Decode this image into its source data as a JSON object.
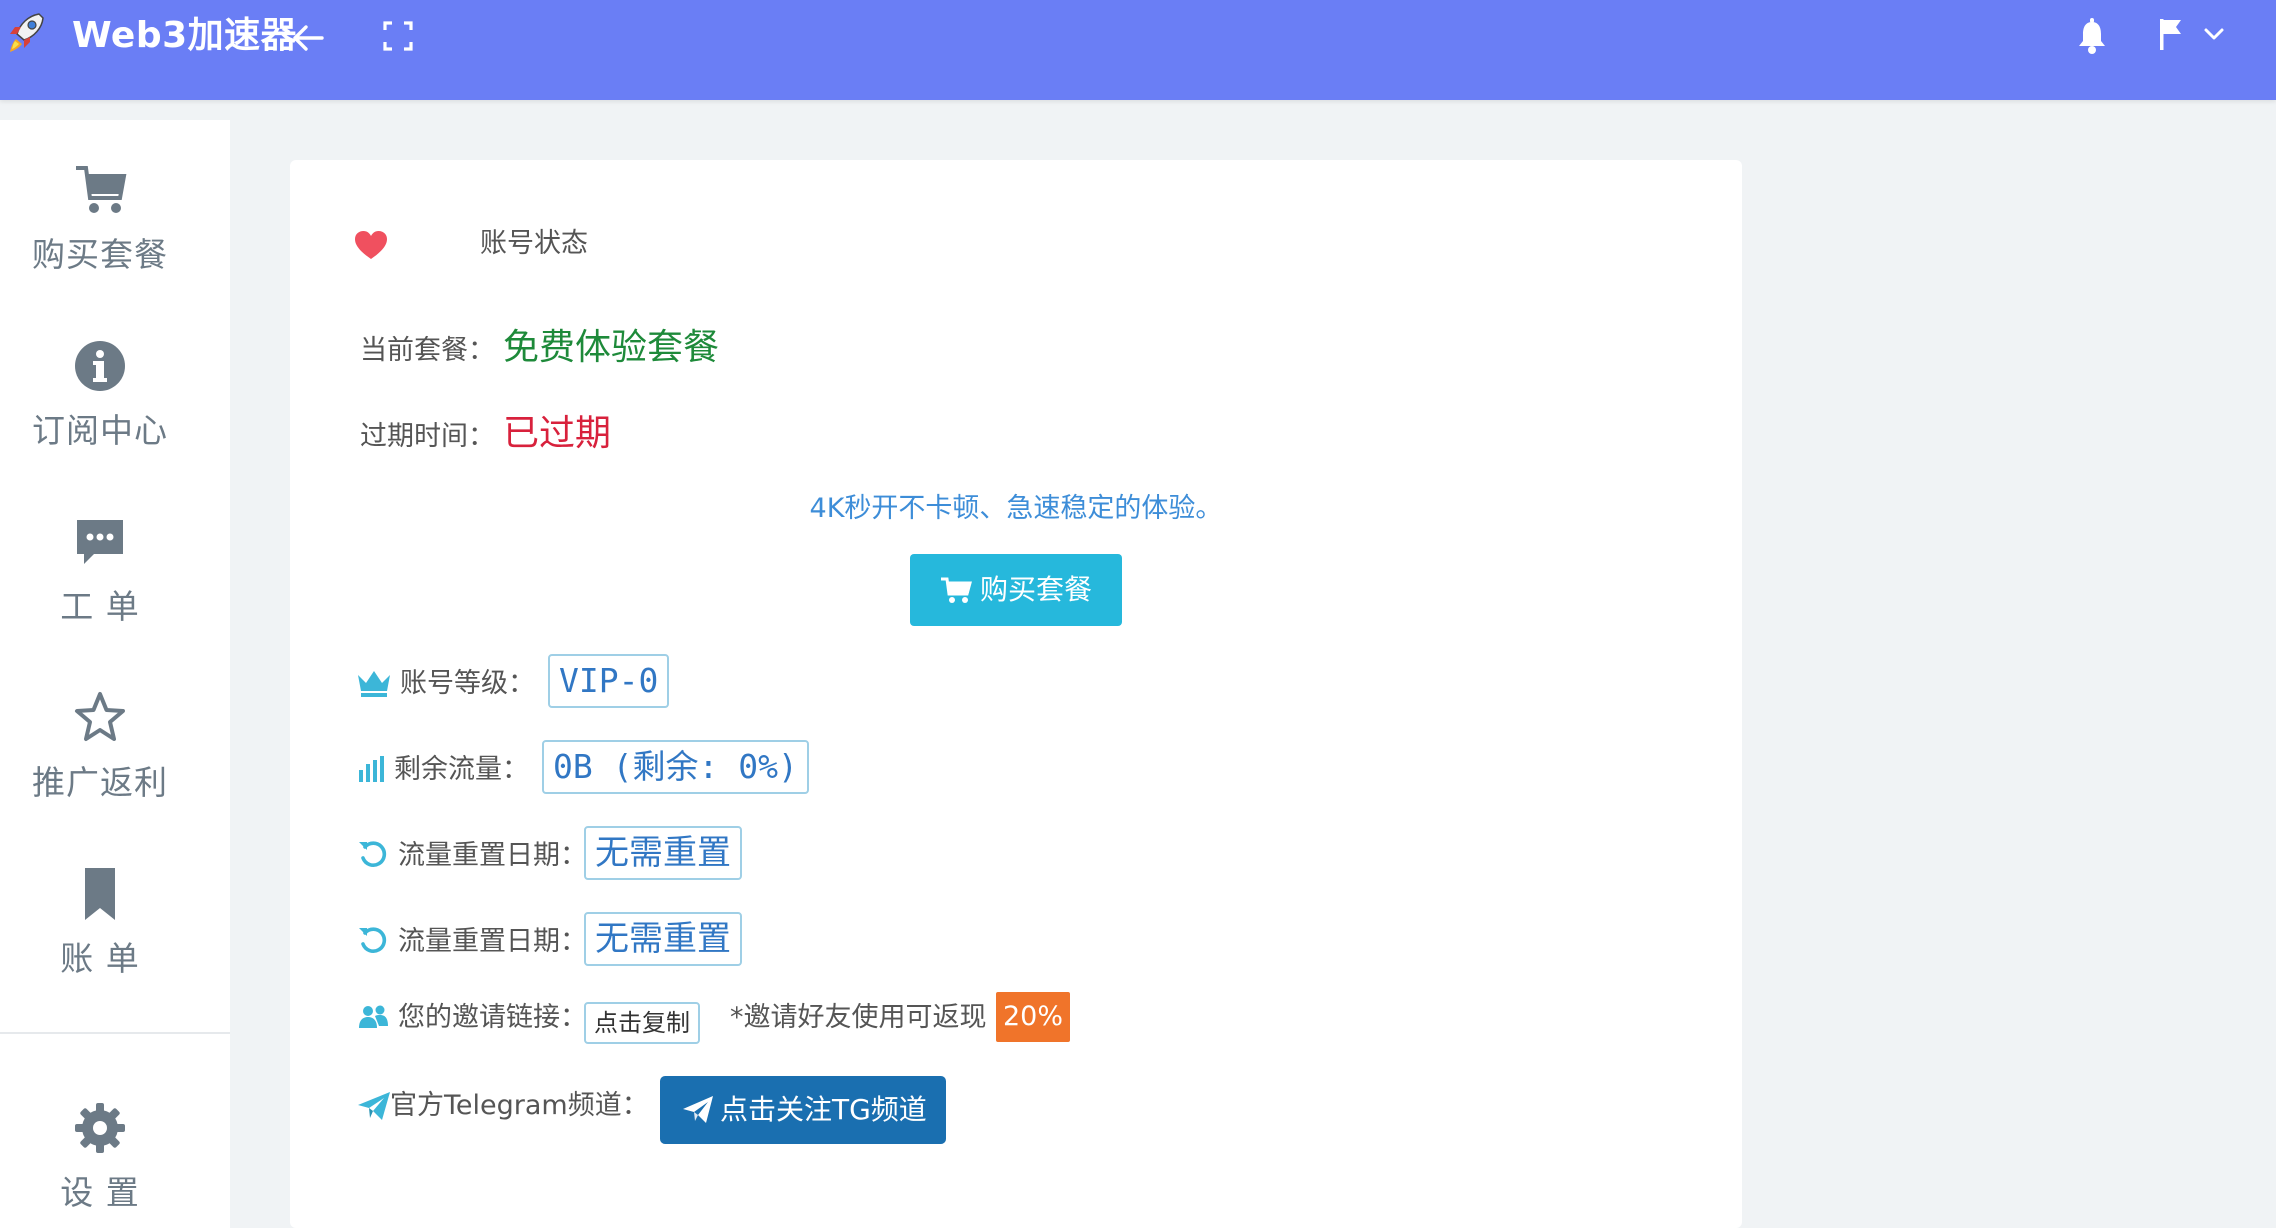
{
  "header": {
    "brand": "Web3加速器",
    "icons": [
      "rocket-logo",
      "arrow-left-icon",
      "fullscreen-icon",
      "bell-icon",
      "flag-icon",
      "chevron-down-icon"
    ]
  },
  "sidebar": {
    "items": [
      {
        "label": "购买套餐",
        "icon": "shopping-cart-icon"
      },
      {
        "label": "订阅中心",
        "icon": "info-circle-icon"
      },
      {
        "label": "工 单",
        "icon": "comment-dots-icon"
      },
      {
        "label": "推广返利",
        "icon": "star-icon"
      },
      {
        "label": "账 单",
        "icon": "bookmark-icon"
      },
      {
        "label": "设 置",
        "icon": "gear-icon"
      }
    ]
  },
  "account": {
    "title": "账号状态",
    "plan_label": "当前套餐：",
    "plan_value": "免费体验套餐",
    "expiry_label": "过期时间：",
    "expiry_value": "已过期",
    "promo": "4K秒开不卡顿、急速稳定的体验。",
    "buy_button": "购买套餐",
    "level_label": "账号等级：",
    "level_value": "VIP-0",
    "traffic_label": "剩余流量：",
    "traffic_value": "0B (剩余: 0%)",
    "reset_label_1": "流量重置日期：",
    "reset_value_1": "无需重置",
    "reset_label_2": "流量重置日期：",
    "reset_value_2": "无需重置",
    "invite_label": "您的邀请链接：",
    "invite_copy": "点击复制",
    "invite_note": "*邀请好友使用可返现",
    "invite_percent": "20%",
    "telegram_label": "官方Telegram频道：",
    "telegram_button": "点击关注TG频道"
  },
  "colors": {
    "header_bg": "#6a7ef5",
    "plan_green": "#1e8a3a",
    "expired_red": "#d8213c",
    "promo_blue": "#3d8dd8",
    "buy_button_bg": "#26b8dc",
    "tg_button_bg": "#1a6fb0",
    "percent_badge_bg": "#f0742a"
  }
}
